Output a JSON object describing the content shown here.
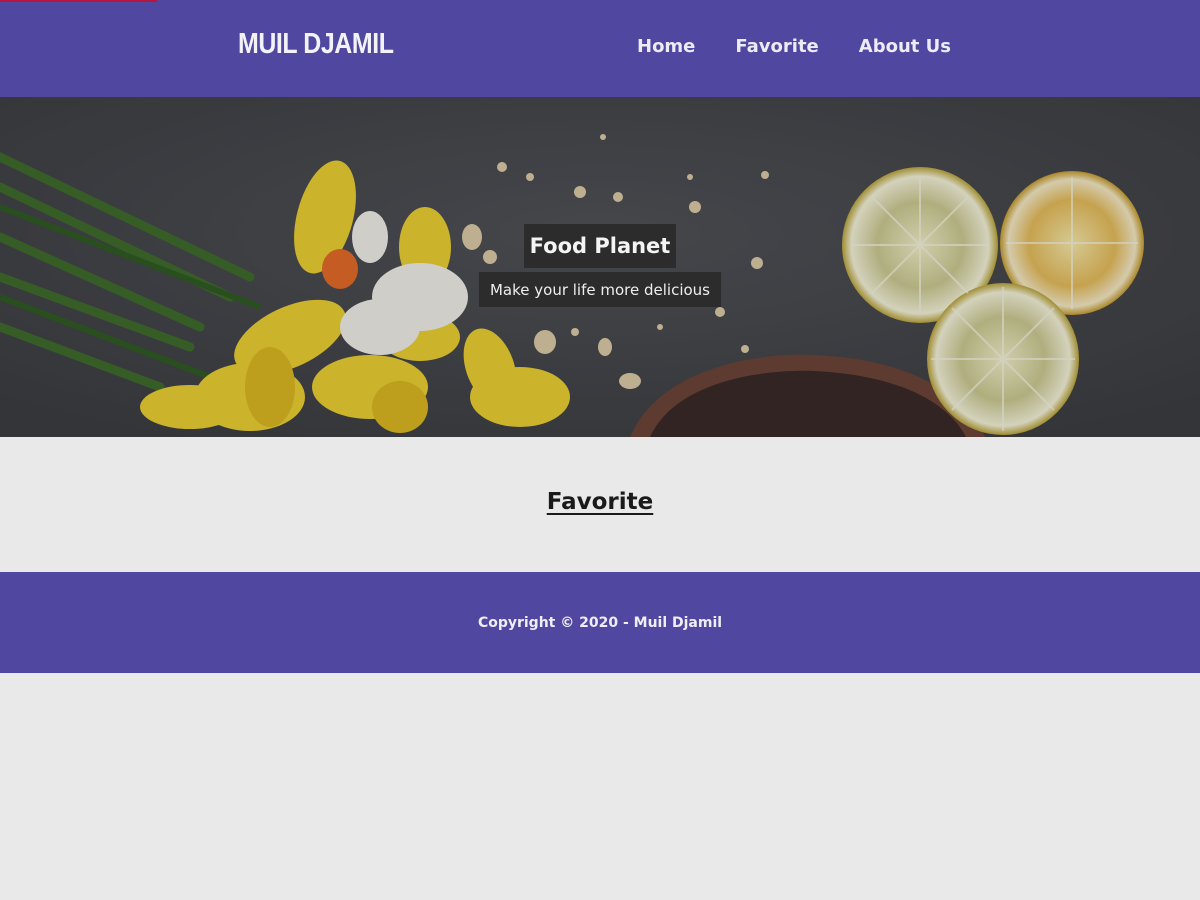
{
  "header": {
    "brand": "MUIL DJAMIL",
    "nav": [
      "Home",
      "Favorite",
      "About Us"
    ]
  },
  "hero": {
    "title": "Food Planet",
    "subtitle": "Make your life more delicious",
    "image": "food-still-life-photo"
  },
  "main": {
    "section_title": "Favorite"
  },
  "footer": {
    "copyright": "Copyright © 2020 - Muil Djamil"
  },
  "colors": {
    "nav_bg": "#5048a0",
    "page_bg": "#e9e9e9",
    "label_bg": "#2c2c2c",
    "progress": "#b3173d"
  }
}
